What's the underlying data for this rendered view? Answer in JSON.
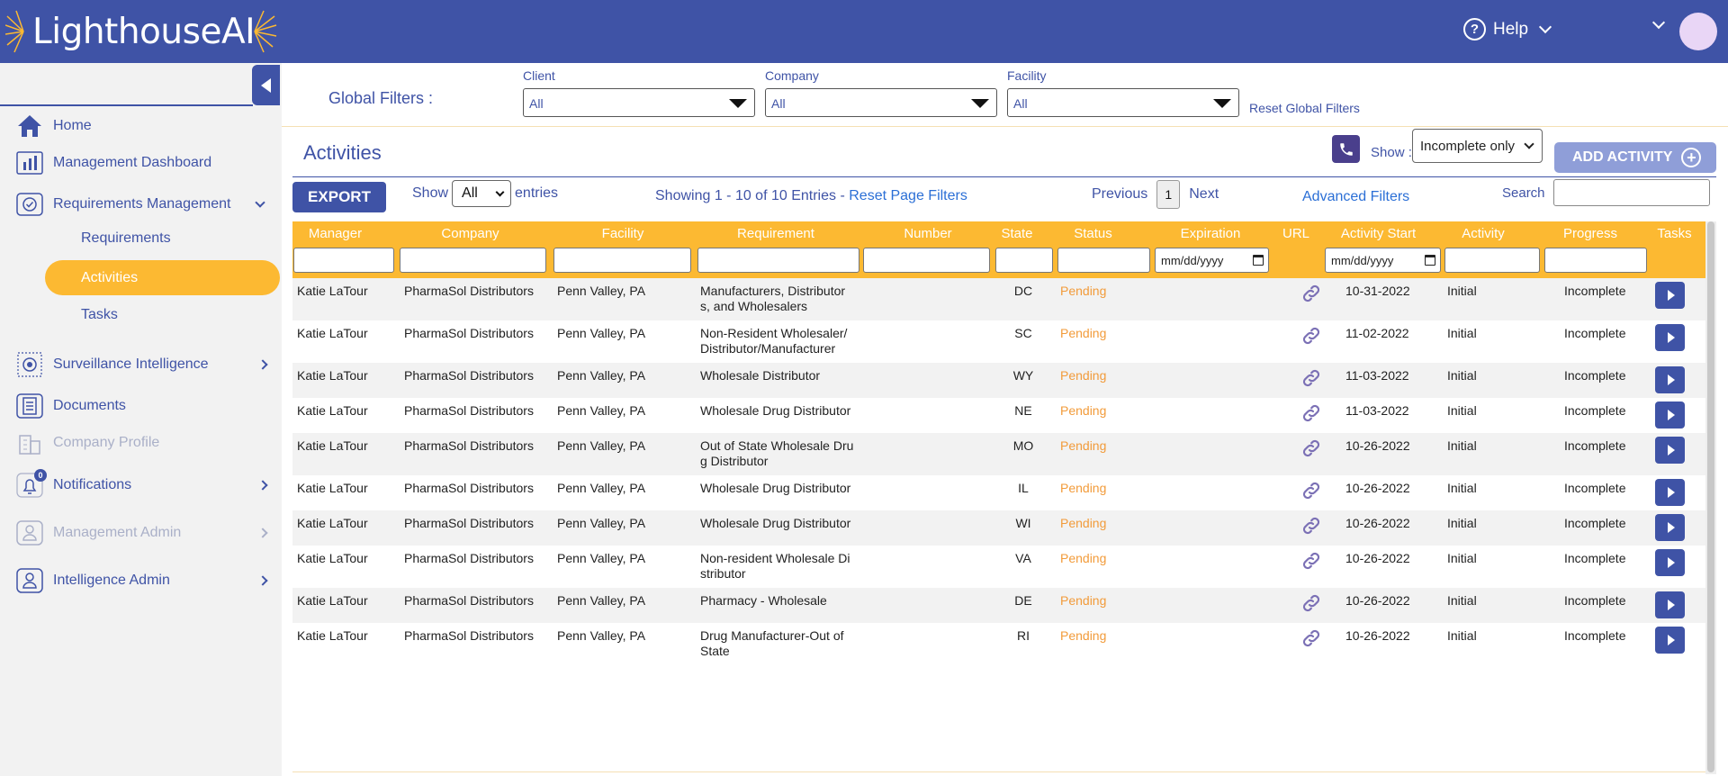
{
  "app": {
    "brand": "LighthouseAI",
    "help_label": "Help"
  },
  "sidebar": {
    "items": [
      {
        "label": "Home",
        "icon": "home-icon"
      },
      {
        "label": "Management Dashboard",
        "icon": "bar-chart-icon"
      },
      {
        "label": "Requirements Management",
        "icon": "check-circle-icon"
      },
      {
        "label": "Surveillance Intelligence",
        "icon": "surveillance-icon"
      },
      {
        "label": "Documents",
        "icon": "document-icon"
      },
      {
        "label": "Company Profile",
        "icon": "building-icon"
      },
      {
        "label": "Notifications",
        "icon": "bell-icon",
        "badge": "0"
      },
      {
        "label": "Management Admin",
        "icon": "user-icon"
      },
      {
        "label": "Intelligence Admin",
        "icon": "user-icon"
      }
    ],
    "sub_items": [
      "Requirements",
      "Activities",
      "Tasks"
    ]
  },
  "global_filters": {
    "label": "Global Filters :",
    "client_label": "Client",
    "client_value": "All",
    "company_label": "Company",
    "company_value": "All",
    "facility_label": "Facility",
    "facility_value": "All",
    "reset_label": "Reset Global Filters"
  },
  "activities": {
    "title": "Activities",
    "show_label": "Show :",
    "show_value": "Incomplete only",
    "add_label": "ADD ACTIVITY"
  },
  "table_controls": {
    "export_label": "EXPORT",
    "show_label": "Show",
    "entries_value": "All",
    "entries_label": "entries",
    "showing_text": "Showing 1 - 10 of 10 Entries - ",
    "reset_page_filters": "Reset Page Filters",
    "previous": "Previous",
    "page": "1",
    "next": "Next",
    "advanced_filters": "Advanced Filters",
    "search_label": "Search"
  },
  "table": {
    "columns": [
      "Manager",
      "Company",
      "Facility",
      "Requirement",
      "Number",
      "State",
      "Status",
      "Expiration",
      "URL",
      "Activity Start",
      "Activity",
      "Progress",
      "Tasks"
    ],
    "date_placeholder": "mm/dd/yyyy",
    "rows": [
      {
        "manager": "Katie LaTour",
        "company": "PharmaSol Distributors",
        "facility": "Penn Valley, PA",
        "requirement": [
          "Manufacturers, Distributor",
          "s, and Wholesalers"
        ],
        "number": "",
        "state": "DC",
        "status": "Pending",
        "expiration": "",
        "start": "10-31-2022",
        "activity": "Initial",
        "progress": "Incomplete"
      },
      {
        "manager": "Katie LaTour",
        "company": "PharmaSol Distributors",
        "facility": "Penn Valley, PA",
        "requirement": [
          "Non-Resident Wholesaler/",
          "Distributor/Manufacturer"
        ],
        "number": "",
        "state": "SC",
        "status": "Pending",
        "expiration": "",
        "start": "11-02-2022",
        "activity": "Initial",
        "progress": "Incomplete"
      },
      {
        "manager": "Katie LaTour",
        "company": "PharmaSol Distributors",
        "facility": "Penn Valley, PA",
        "requirement": [
          "Wholesale Distributor"
        ],
        "number": "",
        "state": "WY",
        "status": "Pending",
        "expiration": "",
        "start": "11-03-2022",
        "activity": "Initial",
        "progress": "Incomplete"
      },
      {
        "manager": "Katie LaTour",
        "company": "PharmaSol Distributors",
        "facility": "Penn Valley, PA",
        "requirement": [
          "Wholesale Drug Distributor"
        ],
        "number": "",
        "state": "NE",
        "status": "Pending",
        "expiration": "",
        "start": "11-03-2022",
        "activity": "Initial",
        "progress": "Incomplete"
      },
      {
        "manager": "Katie LaTour",
        "company": "PharmaSol Distributors",
        "facility": "Penn Valley, PA",
        "requirement": [
          "Out of State Wholesale Dru",
          "g Distributor"
        ],
        "number": "",
        "state": "MO",
        "status": "Pending",
        "expiration": "",
        "start": "10-26-2022",
        "activity": "Initial",
        "progress": "Incomplete"
      },
      {
        "manager": "Katie LaTour",
        "company": "PharmaSol Distributors",
        "facility": "Penn Valley, PA",
        "requirement": [
          "Wholesale Drug Distributor"
        ],
        "number": "",
        "state": "IL",
        "status": "Pending",
        "expiration": "",
        "start": "10-26-2022",
        "activity": "Initial",
        "progress": "Incomplete"
      },
      {
        "manager": "Katie LaTour",
        "company": "PharmaSol Distributors",
        "facility": "Penn Valley, PA",
        "requirement": [
          "Wholesale Drug Distributor"
        ],
        "number": "",
        "state": "WI",
        "status": "Pending",
        "expiration": "",
        "start": "10-26-2022",
        "activity": "Initial",
        "progress": "Incomplete"
      },
      {
        "manager": "Katie LaTour",
        "company": "PharmaSol Distributors",
        "facility": "Penn Valley, PA",
        "requirement": [
          "Non-resident Wholesale Di",
          "stributor"
        ],
        "number": "",
        "state": "VA",
        "status": "Pending",
        "expiration": "",
        "start": "10-26-2022",
        "activity": "Initial",
        "progress": "Incomplete"
      },
      {
        "manager": "Katie LaTour",
        "company": "PharmaSol Distributors",
        "facility": "Penn Valley, PA",
        "requirement": [
          "Pharmacy - Wholesale"
        ],
        "number": "",
        "state": "DE",
        "status": "Pending",
        "expiration": "",
        "start": "10-26-2022",
        "activity": "Initial",
        "progress": "Incomplete"
      },
      {
        "manager": "Katie LaTour",
        "company": "PharmaSol Distributors",
        "facility": "Penn Valley, PA",
        "requirement": [
          "Drug Manufacturer-Out of",
          "State"
        ],
        "number": "",
        "state": "RI",
        "status": "Pending",
        "expiration": "",
        "start": "10-26-2022",
        "activity": "Initial",
        "progress": "Incomplete"
      }
    ]
  },
  "colors": {
    "brand": "#3f53a6",
    "accent": "#fcb932",
    "pending": "#f29b3a"
  }
}
